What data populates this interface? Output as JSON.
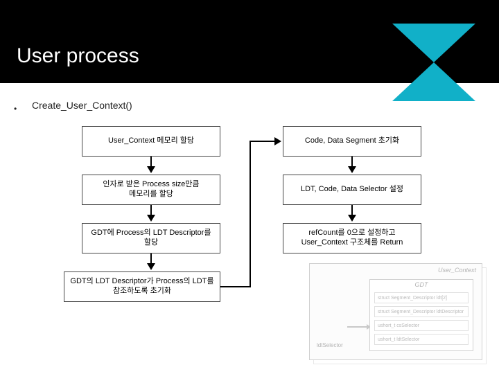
{
  "slide": {
    "title": "User process",
    "bullet": "Create_User_Context()"
  },
  "flow": {
    "left": [
      "User_Context 메모리 할당",
      "인자로 받은 Process size만큼\n메모리를 할당",
      "GDT에 Process의 LDT Descriptor를 할당",
      "GDT의 LDT Descriptor가 Process의 LDT를\n참조하도록 초기화"
    ],
    "right": [
      "Code, Data Segment 초기화",
      "LDT, Code, Data Selector 설정",
      "refCount를 0으로 설정하고\nUser_Context 구조체를 Return"
    ]
  },
  "placeholder": {
    "outer_label": "User_Context",
    "inner_title": "GDT",
    "rows": [
      "struct Segment_Descriptor ldt[2]",
      "struct Segment_Descriptor ldtDescriptor",
      "ushort_t csSelector",
      "ushort_t ldtSelector"
    ],
    "left_label": "ldtSelector"
  },
  "chart_data": {
    "type": "flowchart",
    "title": "Create_User_Context()",
    "nodes": [
      {
        "id": "L1",
        "label": "User_Context 메모리 할당"
      },
      {
        "id": "L2",
        "label": "인자로 받은 Process size만큼 메모리를 할당"
      },
      {
        "id": "L3",
        "label": "GDT에 Process의 LDT Descriptor를 할당"
      },
      {
        "id": "L4",
        "label": "GDT의 LDT Descriptor가 Process의 LDT를 참조하도록 초기화"
      },
      {
        "id": "R1",
        "label": "Code, Data Segment 초기화"
      },
      {
        "id": "R2",
        "label": "LDT, Code, Data Selector 설정"
      },
      {
        "id": "R3",
        "label": "refCount를 0으로 설정하고 User_Context 구조체를 Return"
      }
    ],
    "edges": [
      {
        "from": "L1",
        "to": "L2"
      },
      {
        "from": "L2",
        "to": "L3"
      },
      {
        "from": "L3",
        "to": "L4"
      },
      {
        "from": "L4",
        "to": "R1"
      },
      {
        "from": "R1",
        "to": "R2"
      },
      {
        "from": "R2",
        "to": "R3"
      }
    ]
  }
}
